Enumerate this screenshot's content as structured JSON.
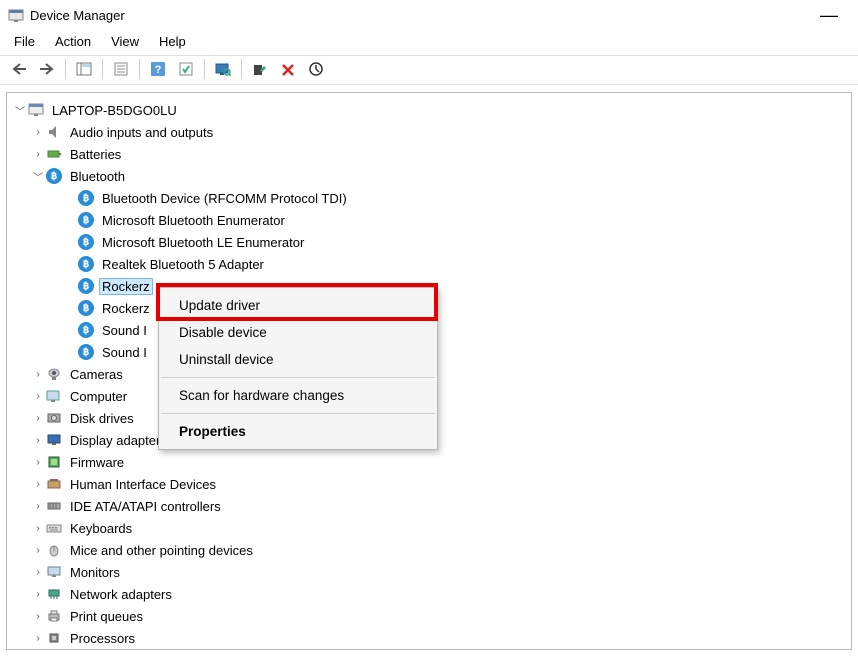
{
  "window": {
    "title": "Device Manager",
    "minimize": "—"
  },
  "menu": {
    "file": "File",
    "action": "Action",
    "view": "View",
    "help": "Help"
  },
  "tree": {
    "root": "LAPTOP-B5DGO0LU",
    "categories": [
      {
        "label": "Audio inputs and outputs",
        "expanded": false
      },
      {
        "label": "Batteries",
        "expanded": false
      },
      {
        "label": "Bluetooth",
        "expanded": true,
        "children": [
          "Bluetooth Device (RFCOMM Protocol TDI)",
          "Microsoft Bluetooth Enumerator",
          "Microsoft Bluetooth LE Enumerator",
          "Realtek Bluetooth 5 Adapter",
          "Rockerz",
          "Rockerz",
          "Sound I",
          "Sound I"
        ]
      },
      {
        "label": "Cameras",
        "expanded": false
      },
      {
        "label": "Computer",
        "expanded": false
      },
      {
        "label": "Disk drives",
        "expanded": false
      },
      {
        "label": "Display adapters",
        "expanded": false
      },
      {
        "label": "Firmware",
        "expanded": false
      },
      {
        "label": "Human Interface Devices",
        "expanded": false
      },
      {
        "label": "IDE ATA/ATAPI controllers",
        "expanded": false
      },
      {
        "label": "Keyboards",
        "expanded": false
      },
      {
        "label": "Mice and other pointing devices",
        "expanded": false
      },
      {
        "label": "Monitors",
        "expanded": false
      },
      {
        "label": "Network adapters",
        "expanded": false
      },
      {
        "label": "Print queues",
        "expanded": false
      },
      {
        "label": "Processors",
        "expanded": false
      }
    ],
    "selected_child_index": 4
  },
  "context_menu": {
    "items": [
      {
        "label": "Update driver",
        "bold": false
      },
      {
        "label": "Disable device",
        "bold": false
      },
      {
        "label": "Uninstall device",
        "bold": false
      },
      {
        "sep": true
      },
      {
        "label": "Scan for hardware changes",
        "bold": false
      },
      {
        "sep": true
      },
      {
        "label": "Properties",
        "bold": true
      }
    ],
    "highlighted_index": 0
  }
}
